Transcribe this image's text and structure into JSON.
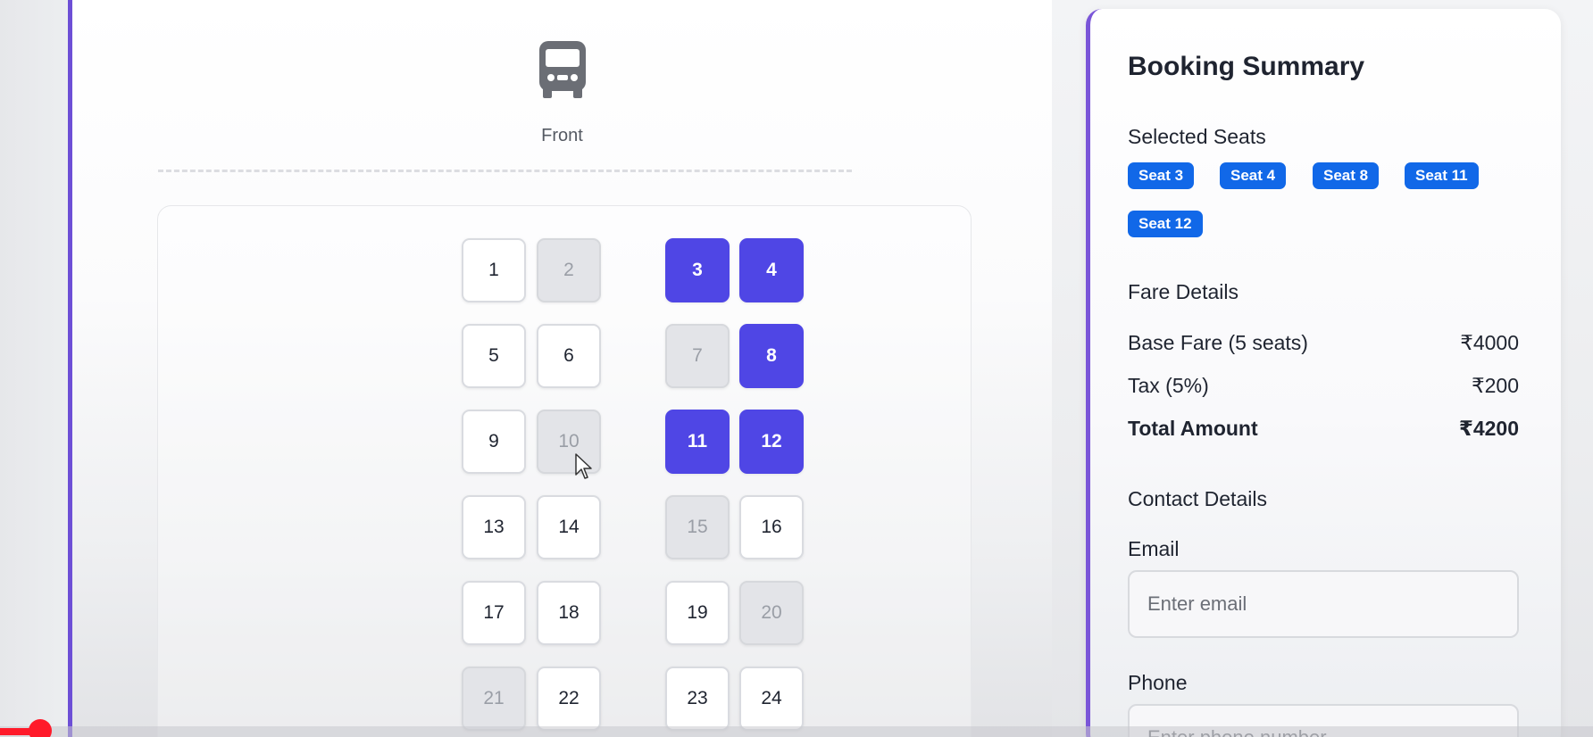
{
  "front": {
    "label": "Front",
    "icon": "bus-icon"
  },
  "seats": [
    {
      "n": "1",
      "state": "available"
    },
    {
      "n": "2",
      "state": "booked"
    },
    {
      "n": "3",
      "state": "selected"
    },
    {
      "n": "4",
      "state": "selected"
    },
    {
      "n": "5",
      "state": "available"
    },
    {
      "n": "6",
      "state": "available"
    },
    {
      "n": "7",
      "state": "booked"
    },
    {
      "n": "8",
      "state": "selected"
    },
    {
      "n": "9",
      "state": "available"
    },
    {
      "n": "10",
      "state": "booked"
    },
    {
      "n": "11",
      "state": "selected"
    },
    {
      "n": "12",
      "state": "selected"
    },
    {
      "n": "13",
      "state": "available"
    },
    {
      "n": "14",
      "state": "available"
    },
    {
      "n": "15",
      "state": "booked"
    },
    {
      "n": "16",
      "state": "available"
    },
    {
      "n": "17",
      "state": "available"
    },
    {
      "n": "18",
      "state": "available"
    },
    {
      "n": "19",
      "state": "available"
    },
    {
      "n": "20",
      "state": "booked"
    },
    {
      "n": "21",
      "state": "booked"
    },
    {
      "n": "22",
      "state": "available"
    },
    {
      "n": "23",
      "state": "available"
    },
    {
      "n": "24",
      "state": "available"
    }
  ],
  "summary": {
    "title": "Booking Summary",
    "selected_label": "Selected Seats",
    "chips": [
      "Seat 3",
      "Seat 4",
      "Seat 8",
      "Seat 11",
      "Seat 12"
    ],
    "fare_label": "Fare Details",
    "base_label": "Base Fare (5 seats)",
    "base_value": "₹4000",
    "tax_label": "Tax (5%)",
    "tax_value": "₹200",
    "total_label": "Total Amount",
    "total_value": "₹4200",
    "contact_label": "Contact Details",
    "email_label": "Email",
    "email_placeholder": "Enter email",
    "phone_label": "Phone",
    "phone_placeholder": "Enter phone number"
  },
  "colors": {
    "selected": "#4f46e5",
    "chip": "#1168e8",
    "accent_border": "#6d4fd6",
    "progress": "#ff1a2a"
  },
  "video_progress": 0.025
}
